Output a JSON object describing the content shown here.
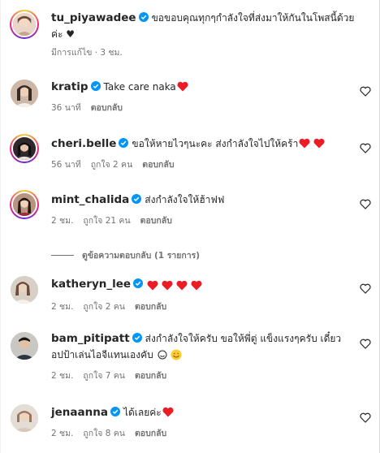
{
  "caption": {
    "username": "tu_piyawadee",
    "text": "ขอขอบคุณทุกๆกำลังใจที่ส่งมาให้กันในโพสนี้ด้วย",
    "text_line2": "ค่ะ ♥",
    "meta": "มีการแก้ไข · 3 ชม."
  },
  "comments": [
    {
      "username": "kratip",
      "text": "Take care naka",
      "time": "36 นาที",
      "likes": "",
      "reply_label": "ตอบกลับ",
      "hearts": 1
    },
    {
      "username": "cheri.belle",
      "text": "ขอให้หายไวๆนะคะ ส่งกำลังใจไปให้คร้า",
      "time": "56 นาที",
      "likes": "ถูกใจ 2 คน",
      "reply_label": "ตอบกลับ",
      "hearts": 2
    },
    {
      "username": "mint_chalida",
      "text": "ส่งกำลังใจให้ฮ้าฟฟ",
      "time": "2 ชม.",
      "likes": "ถูกใจ 21 คน",
      "reply_label": "ตอบกลับ",
      "hearts": 0
    },
    {
      "username": "katheryn_lee",
      "text": "",
      "time": "2 ชม.",
      "likes": "ถูกใจ 2 คน",
      "reply_label": "ตอบกลับ",
      "hearts": 4
    },
    {
      "username": "bam_pitipatt",
      "text": "ส่งกำลังใจให้ครับ ขอให้พี่ตู่ แข็งแรงๆครับ เดี๋ยว",
      "text_line2": "อปป้าเล่นไอจีแทนเองคับ",
      "time": "2 ชม.",
      "likes": "ถูกใจ 7 คน",
      "reply_label": "ตอบกลับ",
      "hearts": 0
    },
    {
      "username": "jenaanna",
      "text": "ได้เลยค่ะ",
      "time": "2 ชม.",
      "likes": "ถูกใจ 8 คน",
      "reply_label": "ตอบกลับ",
      "hearts": 1
    }
  ],
  "view_replies": "ดูข้อความตอบกลับ (1 รายการ)",
  "colors": {
    "verified": "#0095f6",
    "heart": "#ed1c24",
    "meta": "#737373"
  }
}
